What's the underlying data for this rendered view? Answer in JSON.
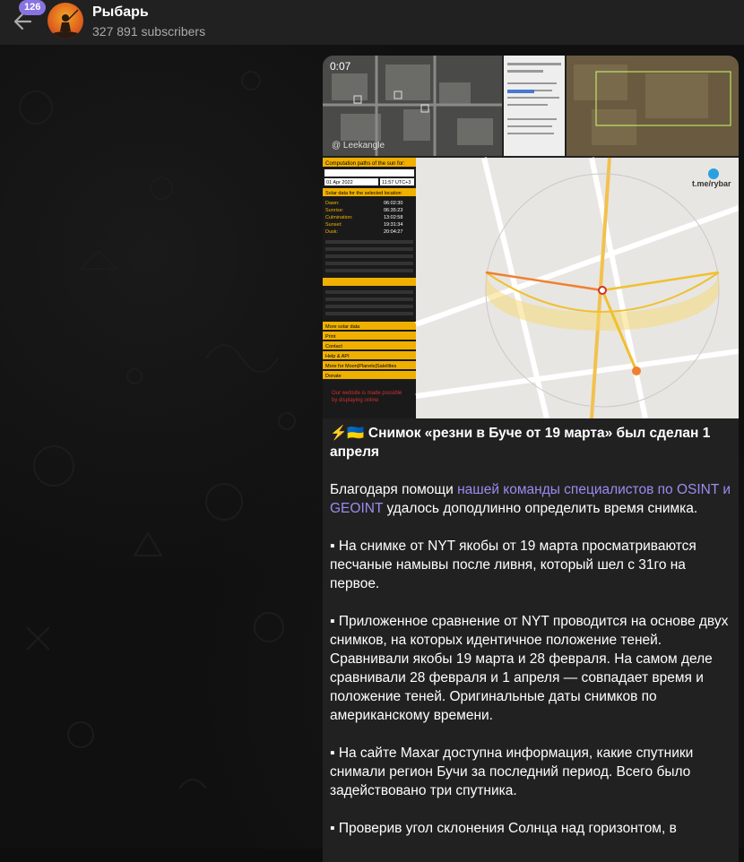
{
  "header": {
    "unread_badge": "126",
    "channel_name": "Рыбарь",
    "subscribers": "327 891 subscribers"
  },
  "media": {
    "video_time": "0:07",
    "watermark": "t.me/rybar",
    "map_sidebar_title": "Computation paths of the sun for:",
    "map_sidebar_date": "01 Apr 2022",
    "map_sidebar_time": "11:57 UTC+3",
    "map_sidebar_section": "Solar data for the selected location",
    "map_sidebar_values": [
      "06:02:30",
      "06:35:23",
      "13:02:58",
      "19:31:34",
      "20:04:27"
    ],
    "map_sidebar_links": [
      "More solar data",
      "Print",
      "Contact",
      "Help & API",
      "More for Moon|Planets|Satellites",
      "Donate"
    ]
  },
  "post": {
    "headline_icons": "⚡🇺🇦",
    "headline": "Снимок «резни в Буче от 19 марта» был сделан 1 апреля",
    "p1_before": "Благодаря помощи ",
    "p1_link": "нашей команды специалистов по OSINT и GEOINT",
    "p1_after": " удалось доподлинно определить время снимка.",
    "bullet": "▪",
    "p2": "На снимке от NYT якобы от 19 марта просматриваются песчаные намывы после ливня, который шел с 31го на первое.",
    "p3": "Приложенное сравнение от NYT проводится на основе двух снимков, на которых идентичное положение теней. Сравнивали якобы 19 марта и 28 февраля. На самом деле сравнивали 28 февраля и 1 апреля — совпадает время и положение теней. Оригинальные даты снимков по американскому времени.",
    "p4": "На сайте Maxar доступна информация, какие спутники снимали регион Бучи за последний период. Всего было задействовано три спутника.",
    "p5": "Проверив угол склонения Солнца над горизонтом, в"
  },
  "colors": {
    "accent": "#8774e1",
    "link": "#9b8cf0",
    "sun_path": "#f0c030",
    "sunrise_line": "#f08030"
  }
}
